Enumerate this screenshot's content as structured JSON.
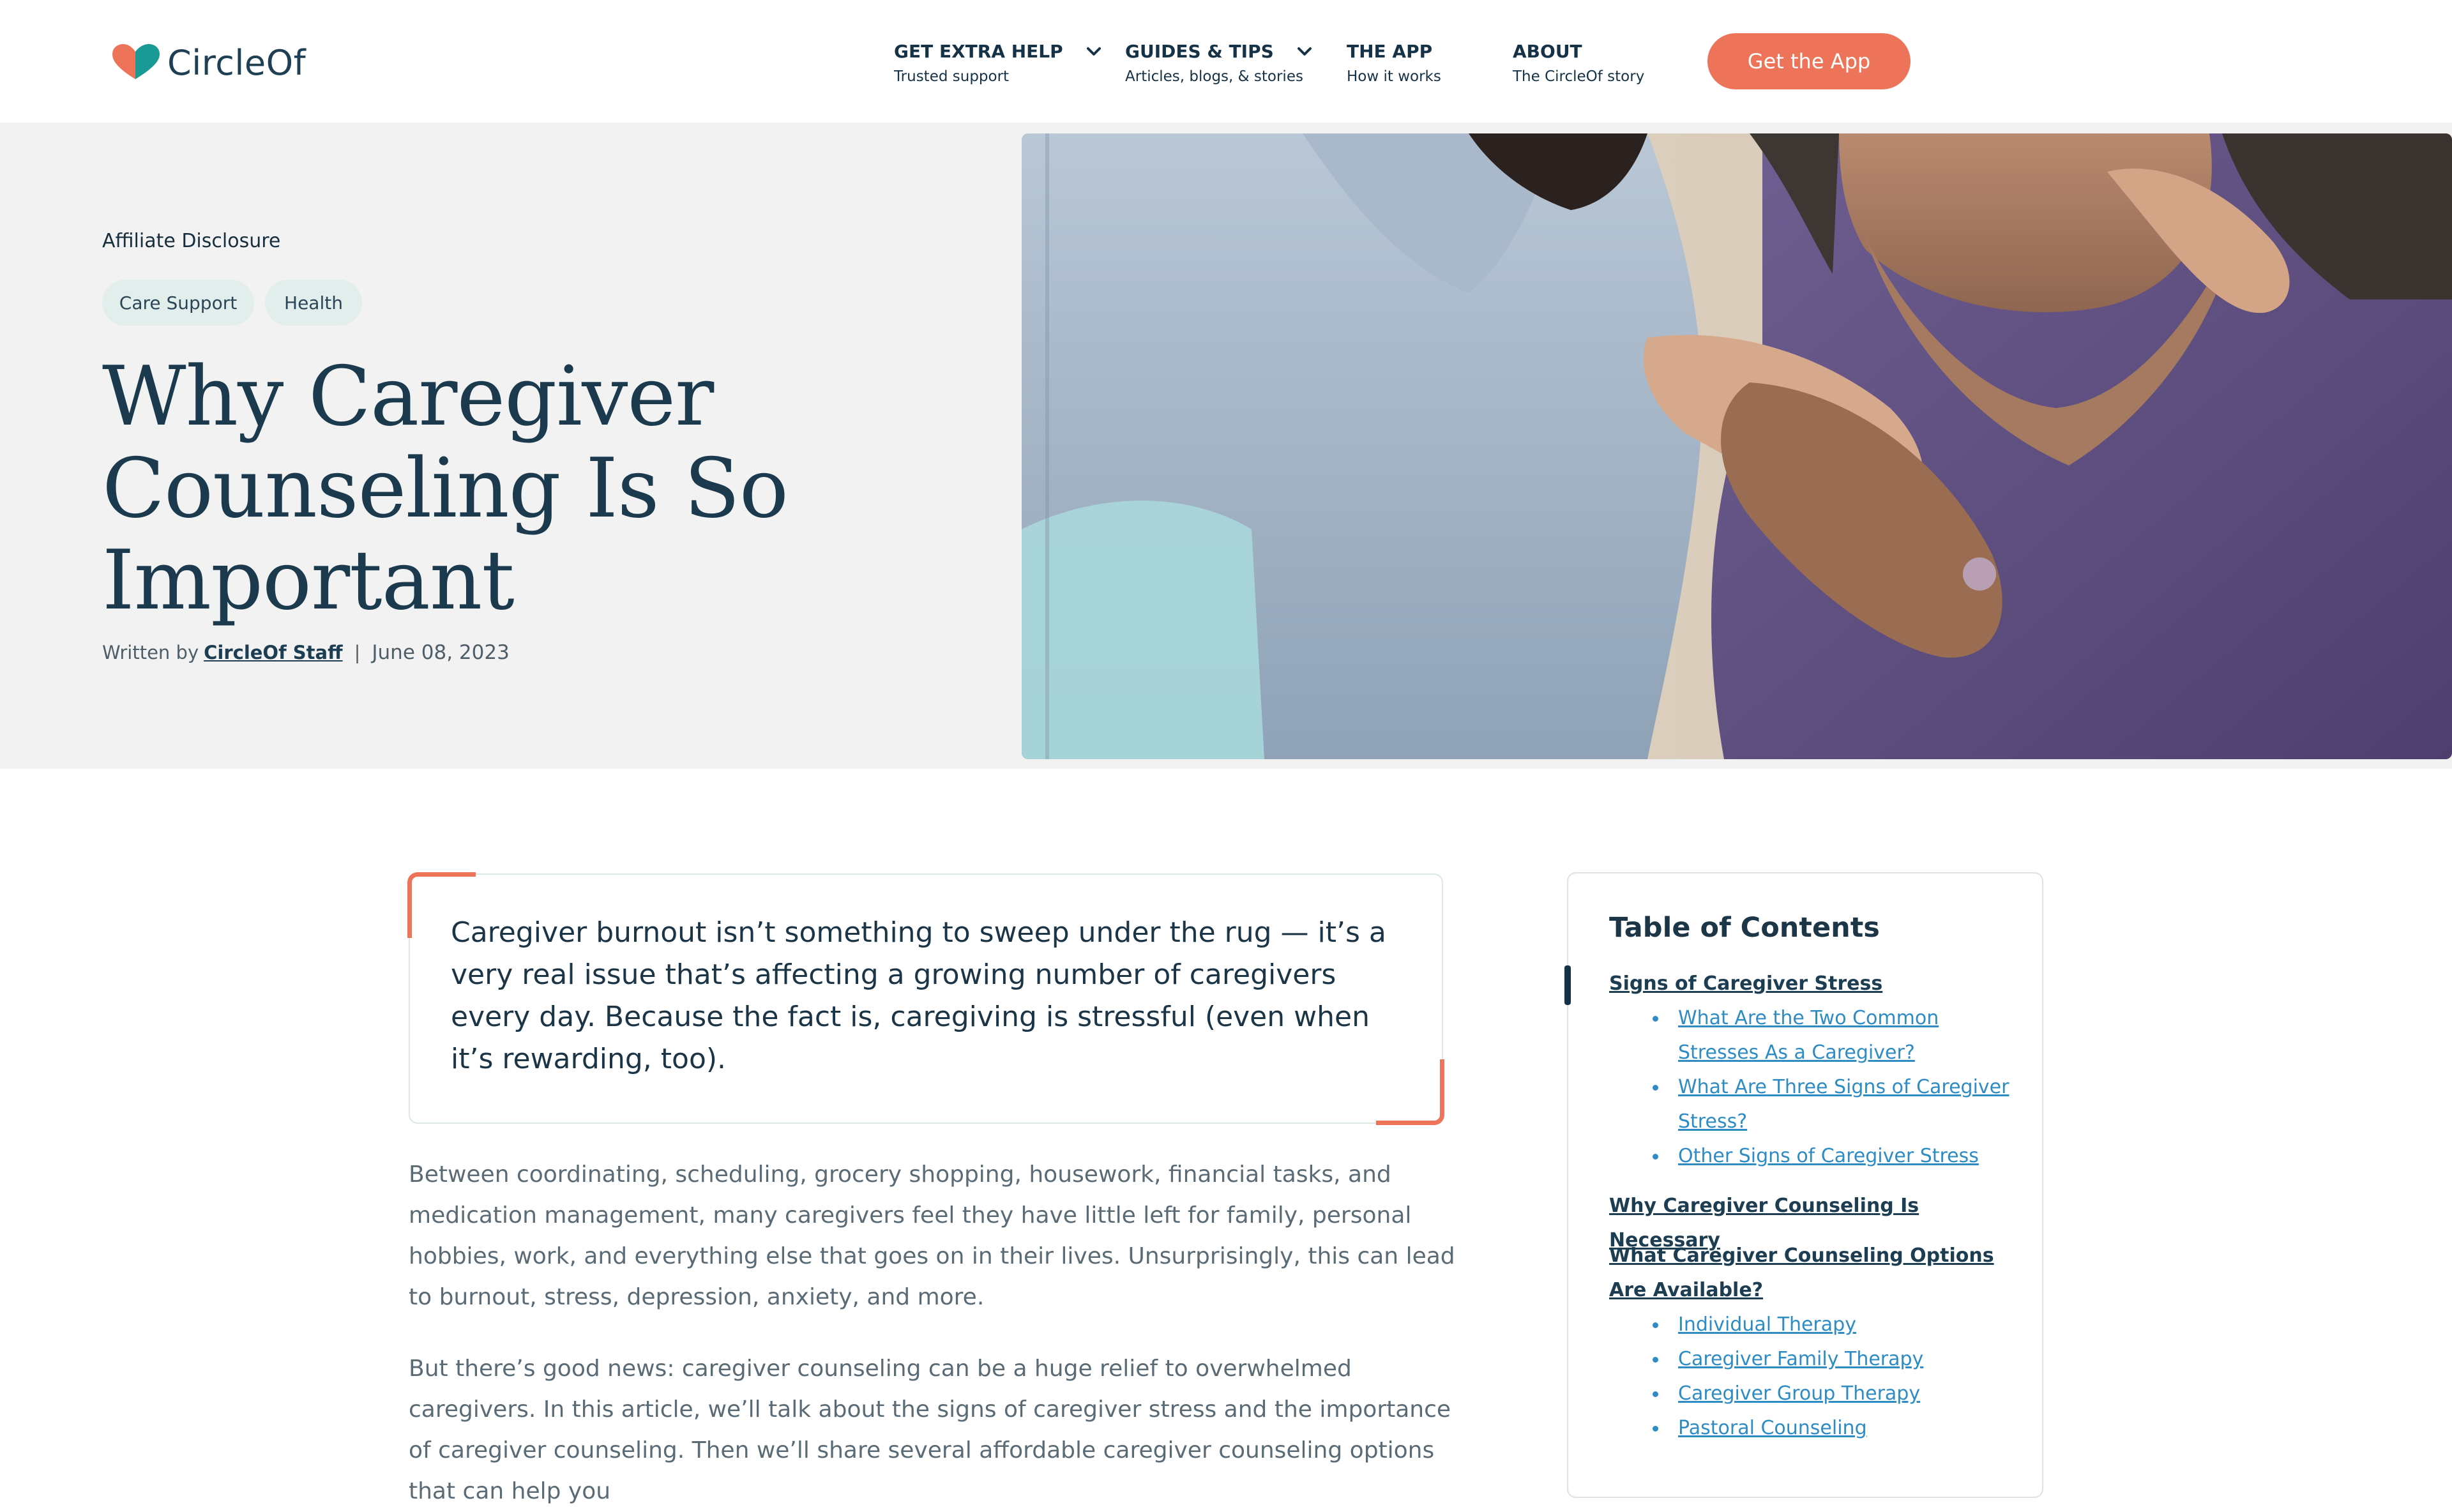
{
  "header": {
    "logo_text": "CircleOf",
    "nav": [
      {
        "title": "GET EXTRA HELP",
        "sub": "Trusted support",
        "has_dropdown": true
      },
      {
        "title": "GUIDES & TIPS",
        "sub": "Articles, blogs, & stories",
        "has_dropdown": true
      },
      {
        "title": "THE APP",
        "sub": "How it works",
        "has_dropdown": false
      },
      {
        "title": "ABOUT",
        "sub": "The CircleOf story",
        "has_dropdown": false
      }
    ],
    "cta_label": "Get the App"
  },
  "hero": {
    "affiliate": "Affiliate Disclosure",
    "tags": [
      "Care Support",
      "Health"
    ],
    "title": "Why Caregiver Counseling Is So Important",
    "byline_prefix": "Written by",
    "author": "CircleOf Staff",
    "separator": "|",
    "date": "June 08, 2023"
  },
  "article": {
    "intro": "Caregiver burnout isn’t something to sweep under the rug — it’s a very real issue that’s affecting a growing number of caregivers every day. Because the fact is, caregiving is stressful (even when it’s rewarding, too).",
    "paragraphs": [
      "Between coordinating, scheduling, grocery shopping, housework, financial tasks, and medication management, many caregivers feel they have little left for family, personal hobbies, work, and everything else that goes on in their lives. Unsurprisingly, this can lead to burnout, stress, depression, anxiety, and more.",
      "But there’s good news: caregiver counseling can be a huge relief to overwhelmed caregivers. In this article, we’ll talk about the signs of caregiver stress and the importance of caregiver counseling. Then we’ll share several affordable caregiver counseling options that can help you"
    ]
  },
  "toc": {
    "title": "Table of Contents",
    "sections": [
      {
        "label": "Signs of Caregiver Stress",
        "active": true,
        "items": [
          "What Are the Two Common Stresses As a Caregiver?",
          "What Are Three Signs of Caregiver Stress?",
          "Other Signs of Caregiver Stress"
        ]
      },
      {
        "label": "Why Caregiver Counseling Is Necessary",
        "active": false,
        "items": []
      },
      {
        "label": "What Caregiver Counseling Options Are Available?",
        "active": false,
        "items": [
          "Individual Therapy",
          "Caregiver Family Therapy",
          "Caregiver Group Therapy",
          "Pastoral Counseling"
        ]
      }
    ]
  },
  "colors": {
    "brand_navy": "#1c3a4e",
    "accent_coral": "#ee7459",
    "brand_teal": "#1a9a94",
    "link_blue": "#2e8cc4",
    "hero_bg": "#f2f2f2",
    "tag_bg": "#e2eeec"
  },
  "icons": [
    "heart-logo-icon",
    "chevron-down-icon"
  ]
}
